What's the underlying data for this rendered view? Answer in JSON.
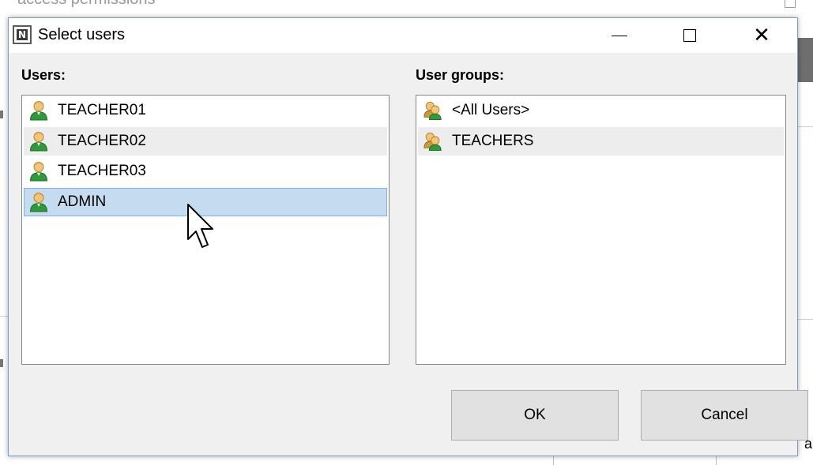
{
  "background": {
    "partial_title": "access permissions",
    "partial_text_bottom_right": "ar"
  },
  "dialog": {
    "title": "Select users",
    "app_icon_letter": "N",
    "window_controls": {
      "minimize": "minimize-icon",
      "maximize": "maximize-icon",
      "close": "close-icon"
    },
    "users_label": "Users:",
    "groups_label": "User groups:",
    "users": [
      {
        "name": "TEACHER01",
        "state": "normal"
      },
      {
        "name": "TEACHER02",
        "state": "alternate"
      },
      {
        "name": "TEACHER03",
        "state": "normal"
      },
      {
        "name": "ADMIN",
        "state": "selected"
      }
    ],
    "groups": [
      {
        "name": "<All Users>",
        "state": "normal"
      },
      {
        "name": "TEACHERS",
        "state": "alternate"
      }
    ],
    "icons": {
      "user": "user-icon",
      "group": "user-group-icon"
    },
    "ok_label": "OK",
    "cancel_label": "Cancel"
  },
  "colors": {
    "selection_fill": "#c5dcf0",
    "selection_border": "#7eb4ea",
    "dialog_background": "#f0f0f0",
    "button_fill": "#e1e1e1"
  }
}
